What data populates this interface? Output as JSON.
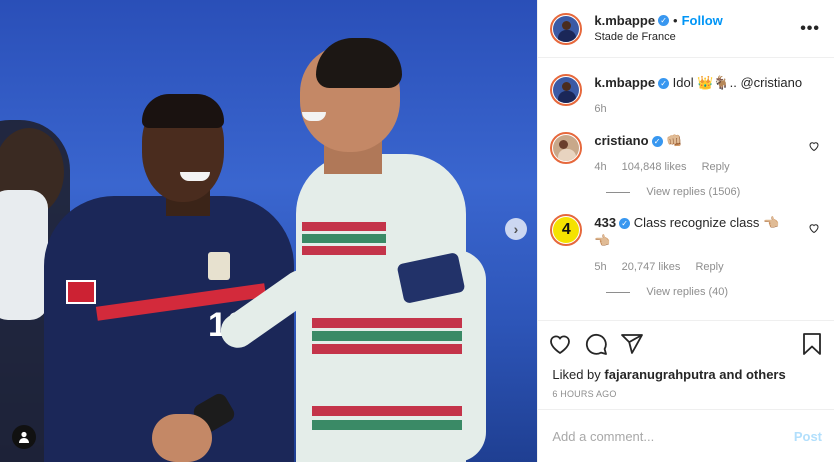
{
  "photo": {
    "alt_icons": {
      "next": "chevron-right-icon",
      "tag": "user-tag-icon"
    },
    "jersey_number": "10"
  },
  "header": {
    "username": "k.mbappe",
    "follow": "Follow",
    "separator": "•",
    "location": "Stade de France"
  },
  "caption": {
    "username": "k.mbappe",
    "text": "Idol 👑🐐.. @cristiano",
    "time": "6h"
  },
  "comments": [
    {
      "username": "cristiano",
      "text": "👊🏼",
      "time": "4h",
      "likes": "104,848 likes",
      "reply": "Reply",
      "view_replies": "View replies (1506)"
    },
    {
      "username": "433",
      "text": "Class recognize class 👈🏼",
      "text2": "👈🏼",
      "time": "5h",
      "likes": "20,747 likes",
      "reply": "Reply",
      "view_replies": "View replies (40)"
    }
  ],
  "likes": {
    "prefix": "Liked by ",
    "user": "fajaranugrahputra",
    "suffix": " and others"
  },
  "age": "6 HOURS AGO",
  "add_comment": {
    "placeholder": "Add a comment...",
    "post": "Post"
  },
  "avatar_433_text": "4",
  "colors": {
    "accent": "#0095f6",
    "verified": "#3897f0",
    "muted": "#8e8e8e"
  }
}
